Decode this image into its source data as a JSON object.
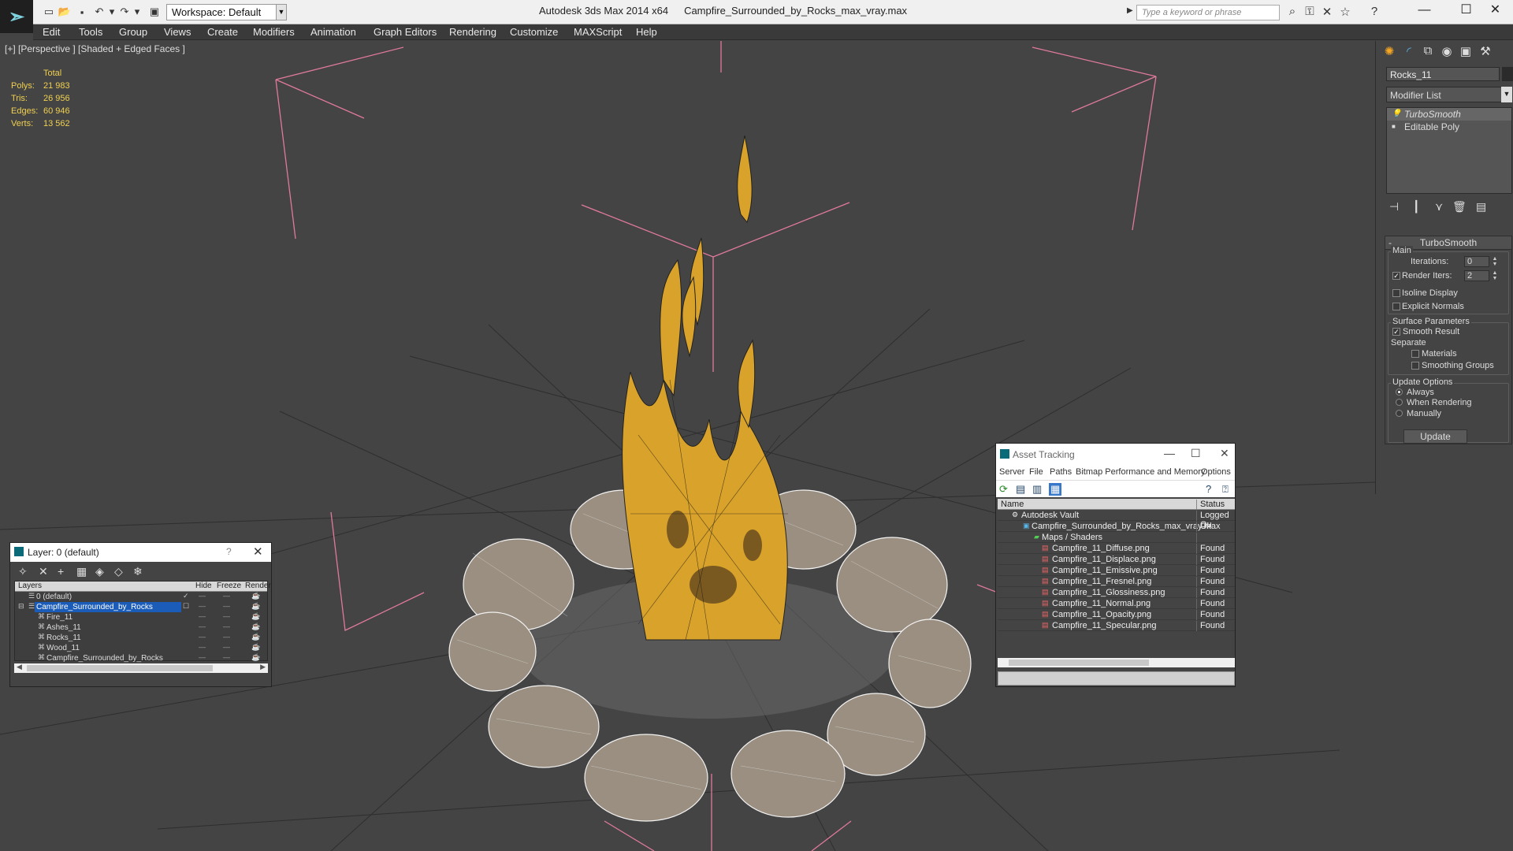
{
  "titlebar": {
    "workspace": "Workspace: Default",
    "app_name": "Autodesk 3ds Max  2014 x64",
    "file_name": "Campfire_Surrounded_by_Rocks_max_vray.max",
    "search_placeholder": "Type a keyword or phrase"
  },
  "menu": [
    "Edit",
    "Tools",
    "Group",
    "Views",
    "Create",
    "Modifiers",
    "Animation",
    "Graph Editors",
    "Rendering",
    "Customize",
    "MAXScript",
    "Help"
  ],
  "viewport": {
    "label": "[+] [Perspective ] [Shaded + Edged Faces ]",
    "stats_header": "Total",
    "stats": [
      {
        "label": "Polys:",
        "value": "21 983"
      },
      {
        "label": "Tris:",
        "value": "26 956"
      },
      {
        "label": "Edges:",
        "value": "60 946"
      },
      {
        "label": "Verts:",
        "value": "13 562"
      }
    ]
  },
  "command_panel": {
    "object_name": "Rocks_11",
    "modifier_list": "Modifier List",
    "stack": [
      {
        "label": "TurboSmooth",
        "selected": true
      },
      {
        "label": "Editable Poly",
        "selected": false
      }
    ],
    "rollout_title": "TurboSmooth",
    "main_group": "Main",
    "iterations_label": "Iterations:",
    "iterations_value": "0",
    "render_iters_label": "Render Iters:",
    "render_iters_value": "2",
    "render_iters_checked": true,
    "isoline_label": "Isoline Display",
    "explicit_normals_label": "Explicit Normals",
    "surface_group": "Surface Parameters",
    "smooth_result_label": "Smooth Result",
    "separate_label": "Separate",
    "materials_label": "Materials",
    "smoothing_groups_label": "Smoothing Groups",
    "update_group": "Update Options",
    "always_label": "Always",
    "when_rendering_label": "When Rendering",
    "manually_label": "Manually",
    "update_button": "Update"
  },
  "layer_window": {
    "title": "Layer: 0 (default)",
    "help": "?",
    "columns": [
      "Layers",
      "Hide",
      "Freeze",
      "Render"
    ],
    "rows": [
      {
        "name": "0 (default)",
        "level": 0,
        "selected": false
      },
      {
        "name": "Campfire_Surrounded_by_Rocks",
        "level": 0,
        "selected": true
      },
      {
        "name": "Fire_11",
        "level": 1,
        "selected": false
      },
      {
        "name": "Ashes_11",
        "level": 1,
        "selected": false
      },
      {
        "name": "Rocks_11",
        "level": 1,
        "selected": false
      },
      {
        "name": "Wood_11",
        "level": 1,
        "selected": false
      },
      {
        "name": "Campfire_Surrounded_by_Rocks",
        "level": 1,
        "selected": false
      }
    ]
  },
  "asset_window": {
    "title": "Asset Tracking",
    "menu": [
      "Server",
      "File",
      "Paths",
      "Bitmap Performance and Memory",
      "Options"
    ],
    "columns": [
      "Name",
      "Status"
    ],
    "rows": [
      {
        "name": "Autodesk Vault",
        "status": "Logged Ou",
        "level": 0,
        "icon": "vault-icon"
      },
      {
        "name": "Campfire_Surrounded_by_Rocks_max_vray.max",
        "status": "Ok",
        "level": 1,
        "icon": "max-file-icon"
      },
      {
        "name": "Maps / Shaders",
        "status": "",
        "level": 2,
        "icon": "maps-icon"
      },
      {
        "name": "Campfire_11_Diffuse.png",
        "status": "Found",
        "level": 3,
        "icon": "png-icon"
      },
      {
        "name": "Campfire_11_Displace.png",
        "status": "Found",
        "level": 3,
        "icon": "png-icon"
      },
      {
        "name": "Campfire_11_Emissive.png",
        "status": "Found",
        "level": 3,
        "icon": "png-icon"
      },
      {
        "name": "Campfire_11_Fresnel.png",
        "status": "Found",
        "level": 3,
        "icon": "png-icon"
      },
      {
        "name": "Campfire_11_Glossiness.png",
        "status": "Found",
        "level": 3,
        "icon": "png-icon"
      },
      {
        "name": "Campfire_11_Normal.png",
        "status": "Found",
        "level": 3,
        "icon": "png-icon"
      },
      {
        "name": "Campfire_11_Opacity.png",
        "status": "Found",
        "level": 3,
        "icon": "png-icon"
      },
      {
        "name": "Campfire_11_Specular.png",
        "status": "Found",
        "level": 3,
        "icon": "png-icon"
      }
    ]
  },
  "colors": {
    "stats_text": "#f0d050",
    "selection": "#1a5cb8",
    "bounding_box": "#e07a9a",
    "viewport_bg": "#444444"
  }
}
